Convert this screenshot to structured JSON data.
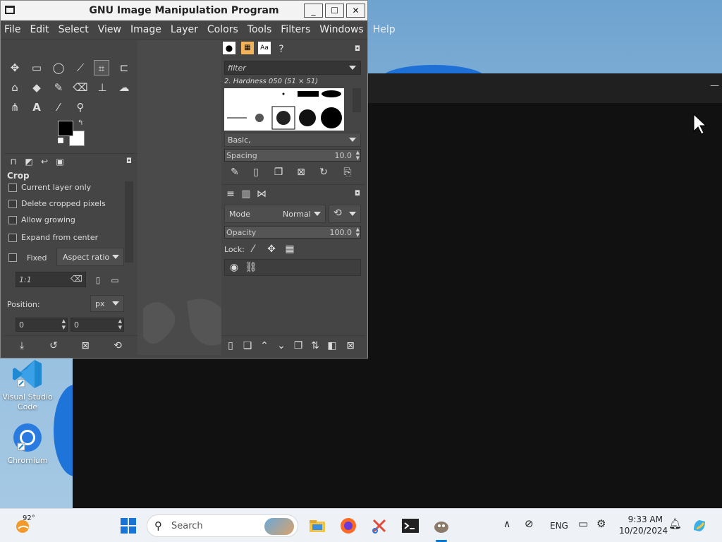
{
  "window": {
    "title": "GNU Image Manipulation Program",
    "minimize": "_",
    "maximize": "☐",
    "close": "✕"
  },
  "menu": [
    "File",
    "Edit",
    "Select",
    "View",
    "Image",
    "Layer",
    "Colors",
    "Tools",
    "Filters",
    "Windows",
    "Help"
  ],
  "tool_options": {
    "heading": "Crop",
    "current_layer_only": "Current layer only",
    "delete_cropped_pixels": "Delete cropped pixels",
    "allow_growing": "Allow growing",
    "expand_from_center": "Expand from center",
    "fixed": "Fixed",
    "aspect_ratio": "Aspect ratio",
    "ratio_value": "1:1",
    "position_label": "Position:",
    "unit": "px",
    "pos_x": "0",
    "pos_y": "0"
  },
  "brushes": {
    "filter_placeholder": "filter",
    "selected_brush": "2. Hardness 050 (51 × 51)",
    "preset": "Basic,",
    "spacing_label": "Spacing",
    "spacing_value": "10.0"
  },
  "layers": {
    "mode_label": "Mode",
    "mode_value": "Normal",
    "opacity_label": "Opacity",
    "opacity_value": "100.0",
    "lock_label": "Lock:"
  },
  "desktop": {
    "vscode_label": "Visual Studio Code",
    "chromium_label": "Chromium"
  },
  "taskbar": {
    "weather": "92°",
    "search_placeholder": "Search",
    "lang": "ENG",
    "time": "9:33 AM",
    "date": "10/20/2024"
  },
  "colors": {
    "gimp_bg": "#454545",
    "accent": "#0078d4"
  }
}
